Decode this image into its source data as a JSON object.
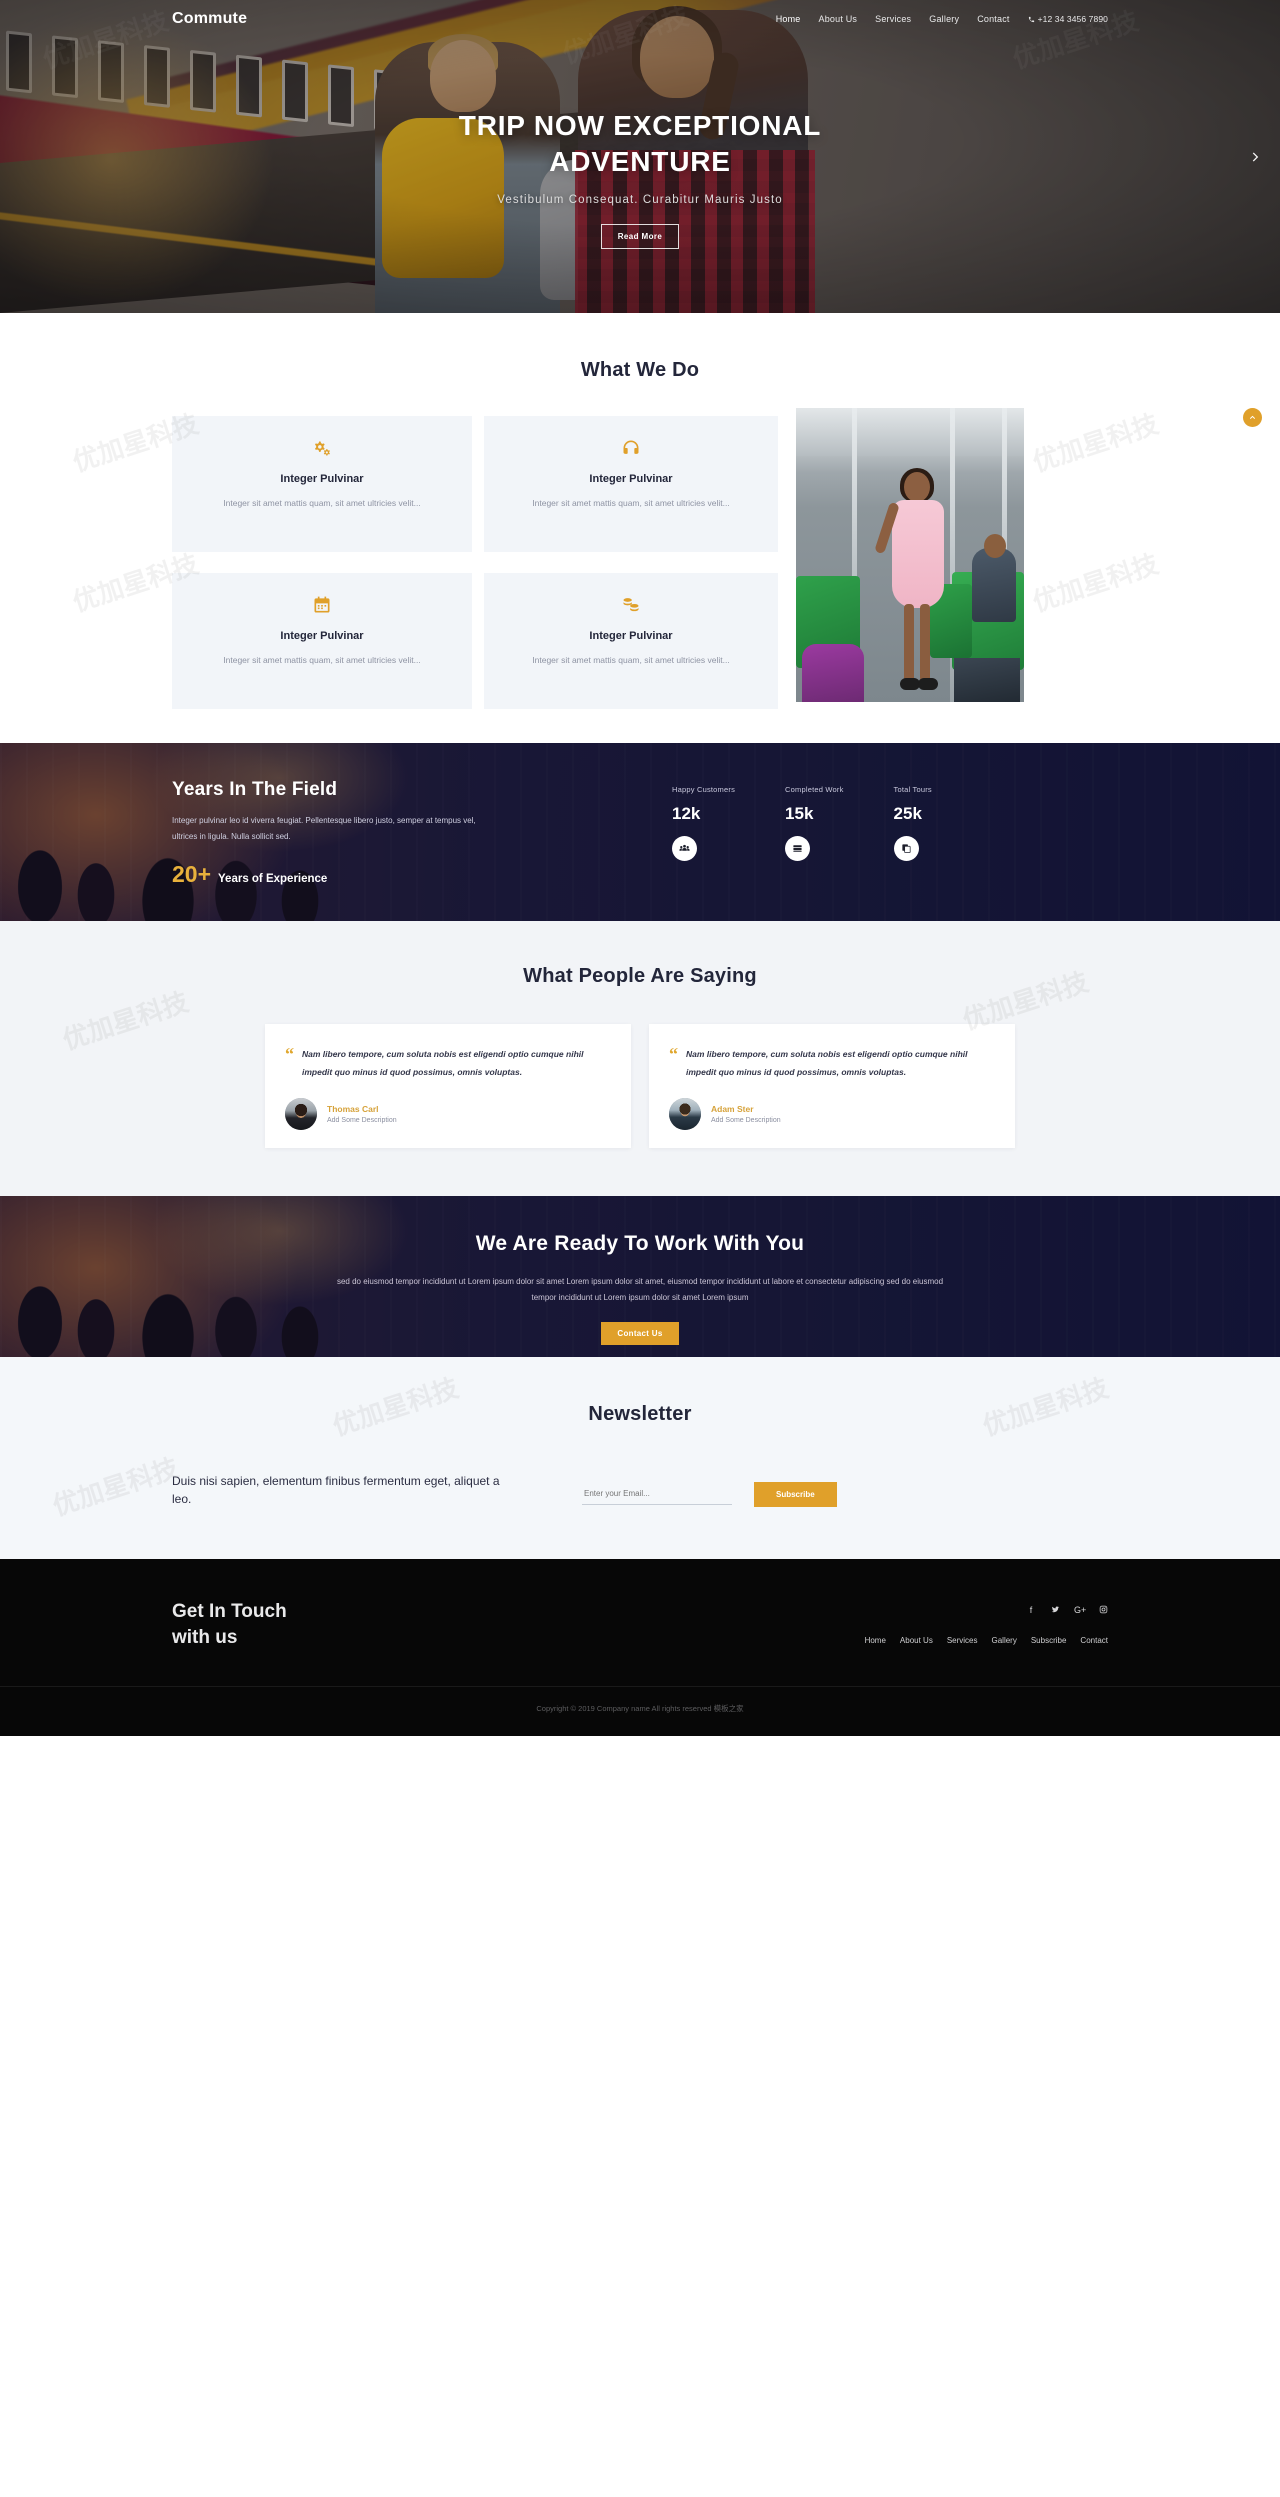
{
  "brand": "Commute",
  "nav": {
    "items": [
      {
        "label": "Home",
        "active": true
      },
      {
        "label": "About Us",
        "active": false
      },
      {
        "label": "Services",
        "active": false
      },
      {
        "label": "Gallery",
        "active": false
      },
      {
        "label": "Contact",
        "active": false
      }
    ],
    "phone": "+12 34 3456 7890",
    "phone_icon": "phone-icon"
  },
  "hero": {
    "title": "TRIP NOW EXCEPTIONAL ADVENTURE",
    "subtitle": "Vestibulum Consequat. Curabitur Mauris Justo",
    "button": "Read More",
    "next_icon": "chevron-right-icon"
  },
  "what_we_do": {
    "title": "What We Do",
    "cards": [
      {
        "icon": "gears-icon",
        "title": "Integer Pulvinar",
        "text": "Integer sit amet mattis quam, sit amet ultricies velit..."
      },
      {
        "icon": "headphones-icon",
        "title": "Integer Pulvinar",
        "text": "Integer sit amet mattis quam, sit amet ultricies velit..."
      },
      {
        "icon": "calendar-icon",
        "title": "Integer Pulvinar",
        "text": "Integer sit amet mattis quam, sit amet ultricies velit..."
      },
      {
        "icon": "coins-icon",
        "title": "Integer Pulvinar",
        "text": "Integer sit amet mattis quam, sit amet ultricies velit..."
      }
    ],
    "scroll_top_icon": "chevron-up-icon"
  },
  "stats": {
    "title": "Years In The Field",
    "description": "Integer pulvinar leo id viverra feugiat. Pellentesque libero justo, semper at tempus vel, ultrices in ligula. Nulla sollicit sed.",
    "experience_number": "20+",
    "experience_label": "Years of Experience",
    "counters": [
      {
        "caption": "Happy Customers",
        "value": "12k",
        "icon": "users-icon"
      },
      {
        "caption": "Completed Work",
        "value": "15k",
        "icon": "server-icon"
      },
      {
        "caption": "Total Tours",
        "value": "25k",
        "icon": "copy-icon"
      }
    ]
  },
  "testimonials": {
    "title": "What People Are Saying",
    "items": [
      {
        "quote_icon": "quote-icon",
        "quote": "Nam libero tempore, cum soluta nobis est eligendi optio cumque nihil impedit quo minus id quod possimus, omnis voluptas.",
        "name": "Thomas Carl",
        "role": "Add Some Description"
      },
      {
        "quote_icon": "quote-icon",
        "quote": "Nam libero tempore, cum soluta nobis est eligendi optio cumque nihil impedit quo minus id quod possimus, omnis voluptas.",
        "name": "Adam Ster",
        "role": "Add Some Description"
      }
    ]
  },
  "cta": {
    "title": "We Are Ready To Work With You",
    "description": "sed do eiusmod tempor incididunt ut Lorem ipsum dolor sit amet Lorem ipsum dolor sit amet, eiusmod tempor incididunt ut labore et consectetur adipiscing sed do eiusmod tempor incididunt ut Lorem ipsum dolor sit amet Lorem ipsum",
    "button": "Contact Us"
  },
  "newsletter": {
    "title": "Newsletter",
    "text": "Duis nisi sapien, elementum finibus fermentum eget, aliquet a leo.",
    "input_placeholder": "Enter your Email...",
    "button": "Subscribe"
  },
  "footer": {
    "title_line1": "Get In Touch",
    "title_line2": "with us",
    "social": [
      {
        "icon": "facebook-icon",
        "glyph": "f"
      },
      {
        "icon": "twitter-icon",
        "glyph": "✉"
      },
      {
        "icon": "google-plus-icon",
        "glyph": "G+"
      },
      {
        "icon": "instagram-icon",
        "glyph": "▣"
      }
    ],
    "links": [
      "Home",
      "About Us",
      "Services",
      "Gallery",
      "Subscribe",
      "Contact"
    ],
    "copyright": "Copyright © 2019 Company name All rights reserved 模板之家"
  },
  "colors": {
    "accent": "#e0a02a",
    "dark": "#23263a",
    "navy": "#1b1c3a",
    "card_bg": "#f2f5f9"
  },
  "watermark": "优加星科技"
}
